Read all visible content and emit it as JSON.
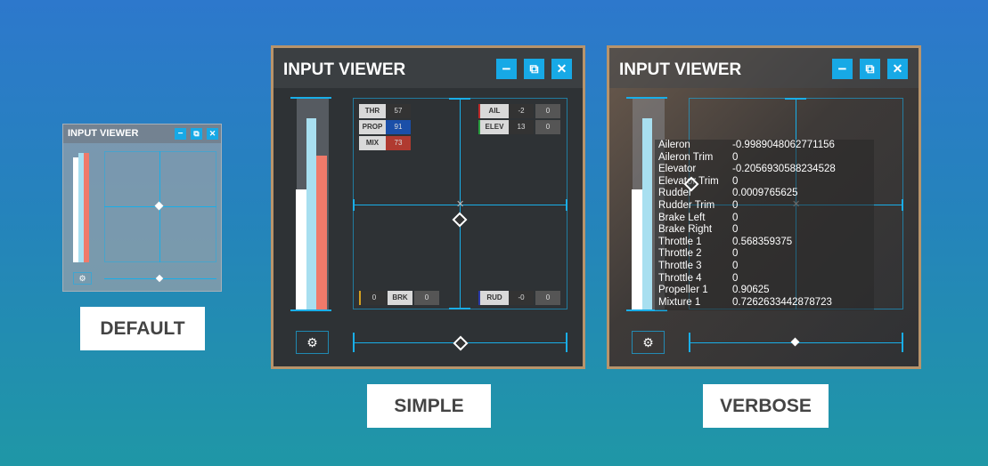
{
  "window_title": "INPUT VIEWER",
  "variants": {
    "default": "DEFAULT",
    "simple": "SIMPLE",
    "verbose": "VERBOSE"
  },
  "controls": {
    "minimize": "−",
    "popout": "⧉",
    "close": "✕",
    "settings": "⚙"
  },
  "simple_chips": {
    "thr": {
      "label": "THR",
      "value": "57"
    },
    "prop": {
      "label": "PROP",
      "value": "91"
    },
    "mix": {
      "label": "MIX",
      "value": "73"
    },
    "ail": {
      "label": "AIL",
      "value": "-2",
      "trim": "0"
    },
    "elev": {
      "label": "ELEV",
      "value": "13",
      "trim": "0"
    },
    "brk": {
      "label": "BRK",
      "left": "0",
      "right": "0"
    },
    "rud": {
      "label": "RUD",
      "value": "-0",
      "trim": "0"
    }
  },
  "verbose_rows": [
    {
      "name": "Aileron",
      "value": "-0.9989048062771156"
    },
    {
      "name": "Aileron Trim",
      "value": "0"
    },
    {
      "name": "Elevator",
      "value": "-0.2056930588234528"
    },
    {
      "name": "Elevator Trim",
      "value": "0"
    },
    {
      "name": "Rudder",
      "value": "0.0009765625"
    },
    {
      "name": "Rudder Trim",
      "value": "0"
    },
    {
      "name": "Brake Left",
      "value": "0"
    },
    {
      "name": "Brake Right",
      "value": "0"
    },
    {
      "name": "Throttle 1",
      "value": "0.568359375"
    },
    {
      "name": "Throttle 2",
      "value": "0"
    },
    {
      "name": "Throttle 3",
      "value": "0"
    },
    {
      "name": "Throttle 4",
      "value": "0"
    },
    {
      "name": "Propeller 1",
      "value": "0.90625"
    },
    {
      "name": "Mixture 1",
      "value": "0.7262633442878723"
    }
  ],
  "levels": {
    "throttle": 0.57,
    "propeller": 0.91,
    "mixture": 0.73
  },
  "colors": {
    "accent": "#19aee8",
    "mixture": "#f07a6a",
    "throttle": "#ffffff",
    "propeller": "#a8dff0",
    "frame": "#b8946b"
  }
}
